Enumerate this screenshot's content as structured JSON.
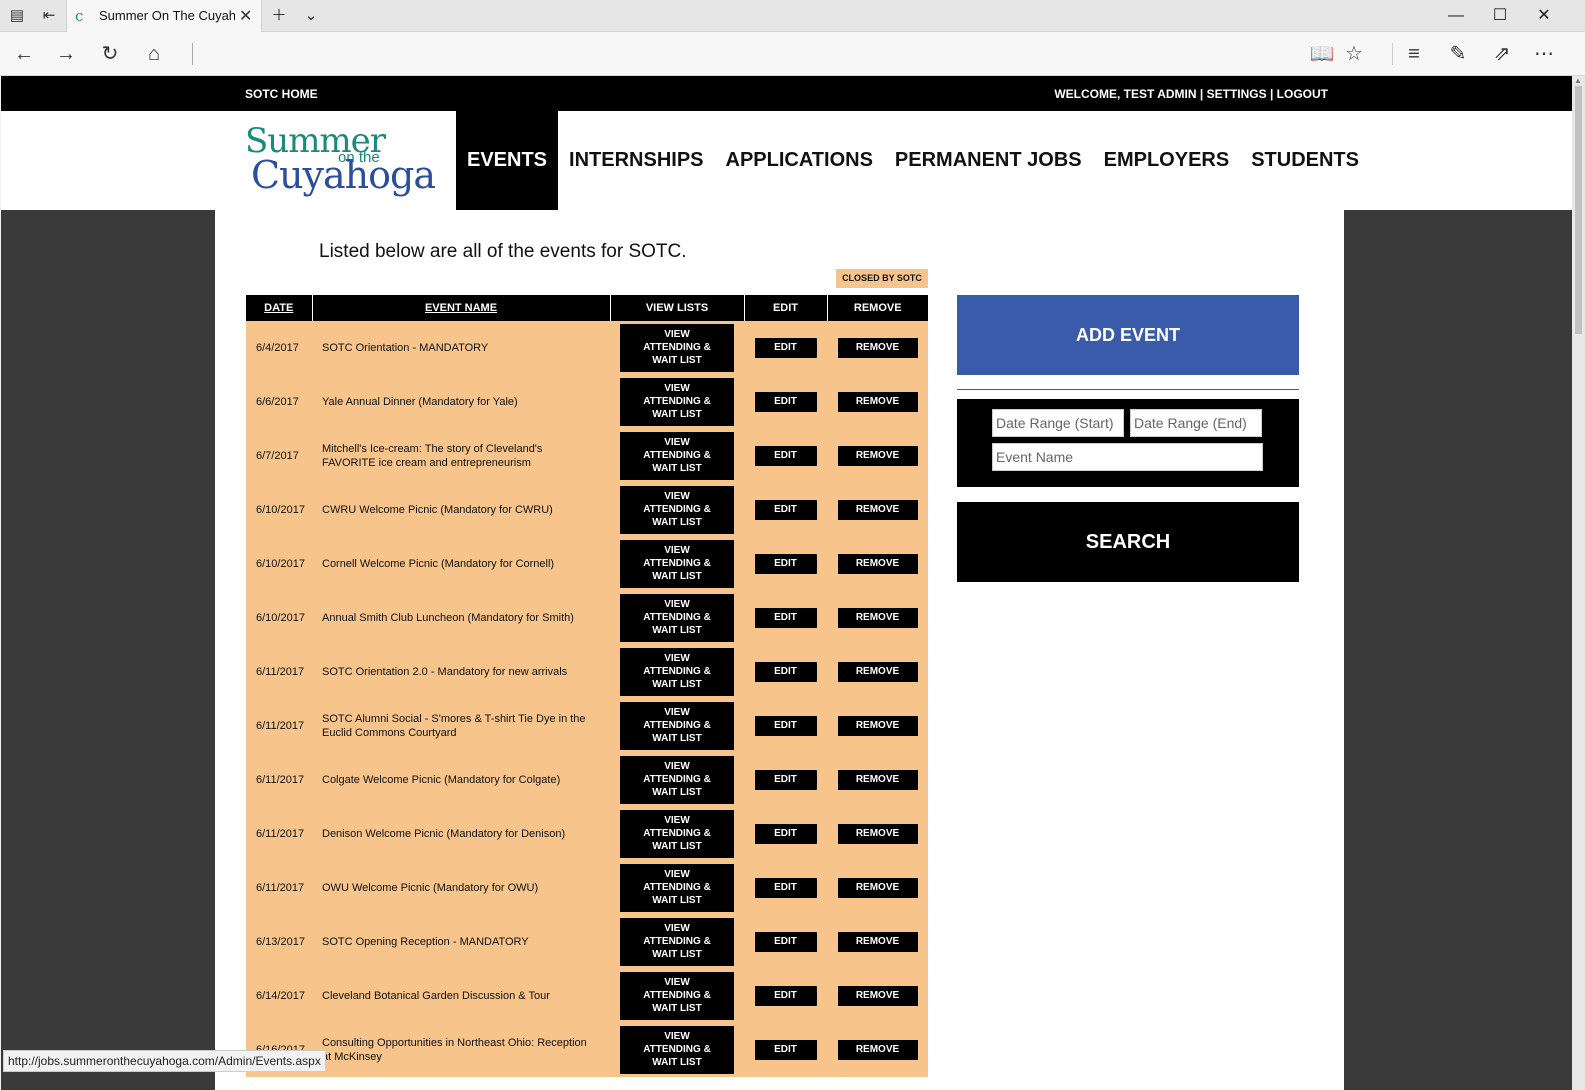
{
  "browser": {
    "tab_title": "Summer On The Cuyahoga",
    "favicon": "ⅽ",
    "status_url": "http://jobs.summeronthecuyahoga.com/Admin/Events.aspx"
  },
  "topbar": {
    "home_label": "SOTC HOME",
    "welcome": "WELCOME, TEST ADMIN",
    "sep": "|",
    "settings": "SETTINGS",
    "logout": "LOGOUT"
  },
  "logo": {
    "line1": "Summer",
    "line2": "on the",
    "line3": "Cuyahoga"
  },
  "nav": {
    "items": [
      {
        "label": "EVENTS"
      },
      {
        "label": "INTERNSHIPS"
      },
      {
        "label": "APPLICATIONS"
      },
      {
        "label": "PERMANENT JOBS"
      },
      {
        "label": "EMPLOYERS"
      },
      {
        "label": "STUDENTS"
      }
    ]
  },
  "main": {
    "intro": "Listed below are all of the events for SOTC.",
    "closed_badge": "CLOSED BY SOTC",
    "columns": {
      "date": "DATE",
      "name": "EVENT NAME",
      "view": "VIEW LISTS",
      "edit": "EDIT",
      "remove": "REMOVE"
    },
    "view_label": [
      "VIEW",
      "ATTENDING &",
      "WAIT LIST"
    ],
    "edit_label": "EDIT",
    "remove_label": "REMOVE",
    "rows": [
      {
        "date": "6/4/2017",
        "name": "SOTC Orientation - MANDATORY"
      },
      {
        "date": "6/6/2017",
        "name": "Yale Annual Dinner (Mandatory for Yale)"
      },
      {
        "date": "6/7/2017",
        "name": "Mitchell's Ice-cream: The story of Cleveland's FAVORITE ice cream and entrepreneurism"
      },
      {
        "date": "6/10/2017",
        "name": "CWRU Welcome Picnic (Mandatory for CWRU)"
      },
      {
        "date": "6/10/2017",
        "name": "Cornell Welcome Picnic (Mandatory for Cornell)"
      },
      {
        "date": "6/10/2017",
        "name": "Annual Smith Club Luncheon (Mandatory for Smith)"
      },
      {
        "date": "6/11/2017",
        "name": "SOTC Orientation 2.0 - Mandatory for new arrivals"
      },
      {
        "date": "6/11/2017",
        "name": "SOTC Alumni Social - S'mores & T-shirt Tie Dye in the Euclid Commons Courtyard"
      },
      {
        "date": "6/11/2017",
        "name": "Colgate Welcome Picnic (Mandatory for Colgate)"
      },
      {
        "date": "6/11/2017",
        "name": "Denison Welcome Picnic (Mandatory for Denison)"
      },
      {
        "date": "6/11/2017",
        "name": "OWU Welcome Picnic (Mandatory for OWU)"
      },
      {
        "date": "6/13/2017",
        "name": "SOTC Opening Reception - MANDATORY"
      },
      {
        "date": "6/14/2017",
        "name": "Cleveland Botanical Garden Discussion & Tour"
      },
      {
        "date": "6/16/2017",
        "name": "Consulting Opportunities in Northeast Ohio: Reception at McKinsey"
      }
    ]
  },
  "sidebar": {
    "add_event": "ADD EVENT",
    "date_start_placeholder": "Date Range (Start)",
    "date_end_placeholder": "Date Range (End)",
    "event_name_placeholder": "Event Name",
    "search": "SEARCH"
  }
}
